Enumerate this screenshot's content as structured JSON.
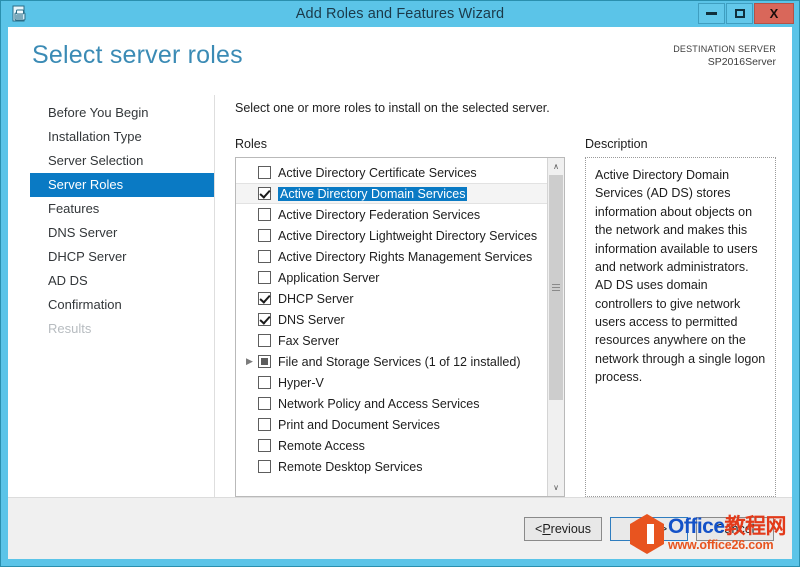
{
  "window": {
    "title": "Add Roles and Features Wizard",
    "icon": "server-wizard-icon",
    "minimize_label": "Minimize",
    "maximize_label": "Maximize",
    "close_label": "X",
    "titlebar_color": "#5bc4e8",
    "close_button_color": "#d9675a"
  },
  "header": {
    "page_title": "Select server roles",
    "destination_label": "DESTINATION SERVER",
    "destination_value": "SP2016Server"
  },
  "sidebar": {
    "items": [
      {
        "label": "Before You Begin",
        "state": "normal"
      },
      {
        "label": "Installation Type",
        "state": "normal"
      },
      {
        "label": "Server Selection",
        "state": "normal"
      },
      {
        "label": "Server Roles",
        "state": "selected"
      },
      {
        "label": "Features",
        "state": "normal"
      },
      {
        "label": "DNS Server",
        "state": "normal"
      },
      {
        "label": "DHCP Server",
        "state": "normal"
      },
      {
        "label": "AD DS",
        "state": "normal"
      },
      {
        "label": "Confirmation",
        "state": "normal"
      },
      {
        "label": "Results",
        "state": "disabled"
      }
    ],
    "selected_color": "#0a7ac4"
  },
  "content": {
    "instruction": "Select one or more roles to install on the selected server.",
    "roles_label": "Roles",
    "description_label": "Description",
    "description_text": "Active Directory Domain Services (AD DS) stores information about objects on the network and makes this information available to users and network administrators. AD DS uses domain controllers to give network users access to permitted resources anywhere on the network through a single logon process.",
    "roles": [
      {
        "label": "Active Directory Certificate Services",
        "checked": "unchecked",
        "expandable": false,
        "selected": false
      },
      {
        "label": "Active Directory Domain Services",
        "checked": "checked",
        "expandable": false,
        "selected": true
      },
      {
        "label": "Active Directory Federation Services",
        "checked": "unchecked",
        "expandable": false,
        "selected": false
      },
      {
        "label": "Active Directory Lightweight Directory Services",
        "checked": "unchecked",
        "expandable": false,
        "selected": false
      },
      {
        "label": "Active Directory Rights Management Services",
        "checked": "unchecked",
        "expandable": false,
        "selected": false
      },
      {
        "label": "Application Server",
        "checked": "unchecked",
        "expandable": false,
        "selected": false
      },
      {
        "label": "DHCP Server",
        "checked": "checked",
        "expandable": false,
        "selected": false
      },
      {
        "label": "DNS Server",
        "checked": "checked",
        "expandable": false,
        "selected": false
      },
      {
        "label": "Fax Server",
        "checked": "unchecked",
        "expandable": false,
        "selected": false
      },
      {
        "label": "File and Storage Services (1 of 12 installed)",
        "checked": "partial",
        "expandable": true,
        "selected": false
      },
      {
        "label": "Hyper-V",
        "checked": "unchecked",
        "expandable": false,
        "selected": false
      },
      {
        "label": "Network Policy and Access Services",
        "checked": "unchecked",
        "expandable": false,
        "selected": false
      },
      {
        "label": "Print and Document Services",
        "checked": "unchecked",
        "expandable": false,
        "selected": false
      },
      {
        "label": "Remote Access",
        "checked": "unchecked",
        "expandable": false,
        "selected": false
      },
      {
        "label": "Remote Desktop Services",
        "checked": "unchecked",
        "expandable": false,
        "selected": false
      }
    ],
    "scrollbar": {
      "up_arrow": "∧",
      "down_arrow": "∨"
    }
  },
  "footer": {
    "previous_label": "< Previous",
    "previous_prefix": "< ",
    "previous_accesskey": "P",
    "previous_suffix": "revious",
    "next_prefix": "",
    "next_accesskey": "N",
    "next_suffix": "ext >",
    "cancel_label": "Cancel"
  },
  "watermark": {
    "brand_en": "Office",
    "brand_cn": "教程网",
    "url": "www.office26.com",
    "logo_color": "#e8541f",
    "text_color": "#1452c8"
  }
}
